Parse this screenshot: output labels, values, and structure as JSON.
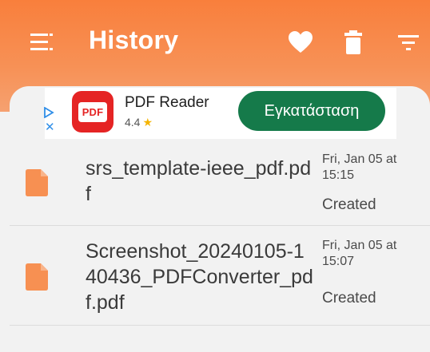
{
  "header": {
    "title": "History",
    "menu_icon": "menu-icon",
    "actions": [
      "heart-icon",
      "trash-icon",
      "filter-icon"
    ],
    "colors": {
      "header_top": "#f97f3c",
      "header_bottom": "#f6a170",
      "file_icon": "#f79052"
    }
  },
  "ad": {
    "app_name": "PDF Reader",
    "icon_text": "PDF",
    "rating": "4.4",
    "install_label": "Εγκατάσταση",
    "close_label": "✕"
  },
  "files": [
    {
      "name": "srs_template-ieee_pdf.pdf",
      "date": "Fri, Jan 05 at 15:15",
      "status": "Created"
    },
    {
      "name": "Screenshot_20240105-140436_PDFConverter_pdf.pdf",
      "date": "Fri, Jan 05 at 15:07",
      "status": "Created"
    }
  ]
}
